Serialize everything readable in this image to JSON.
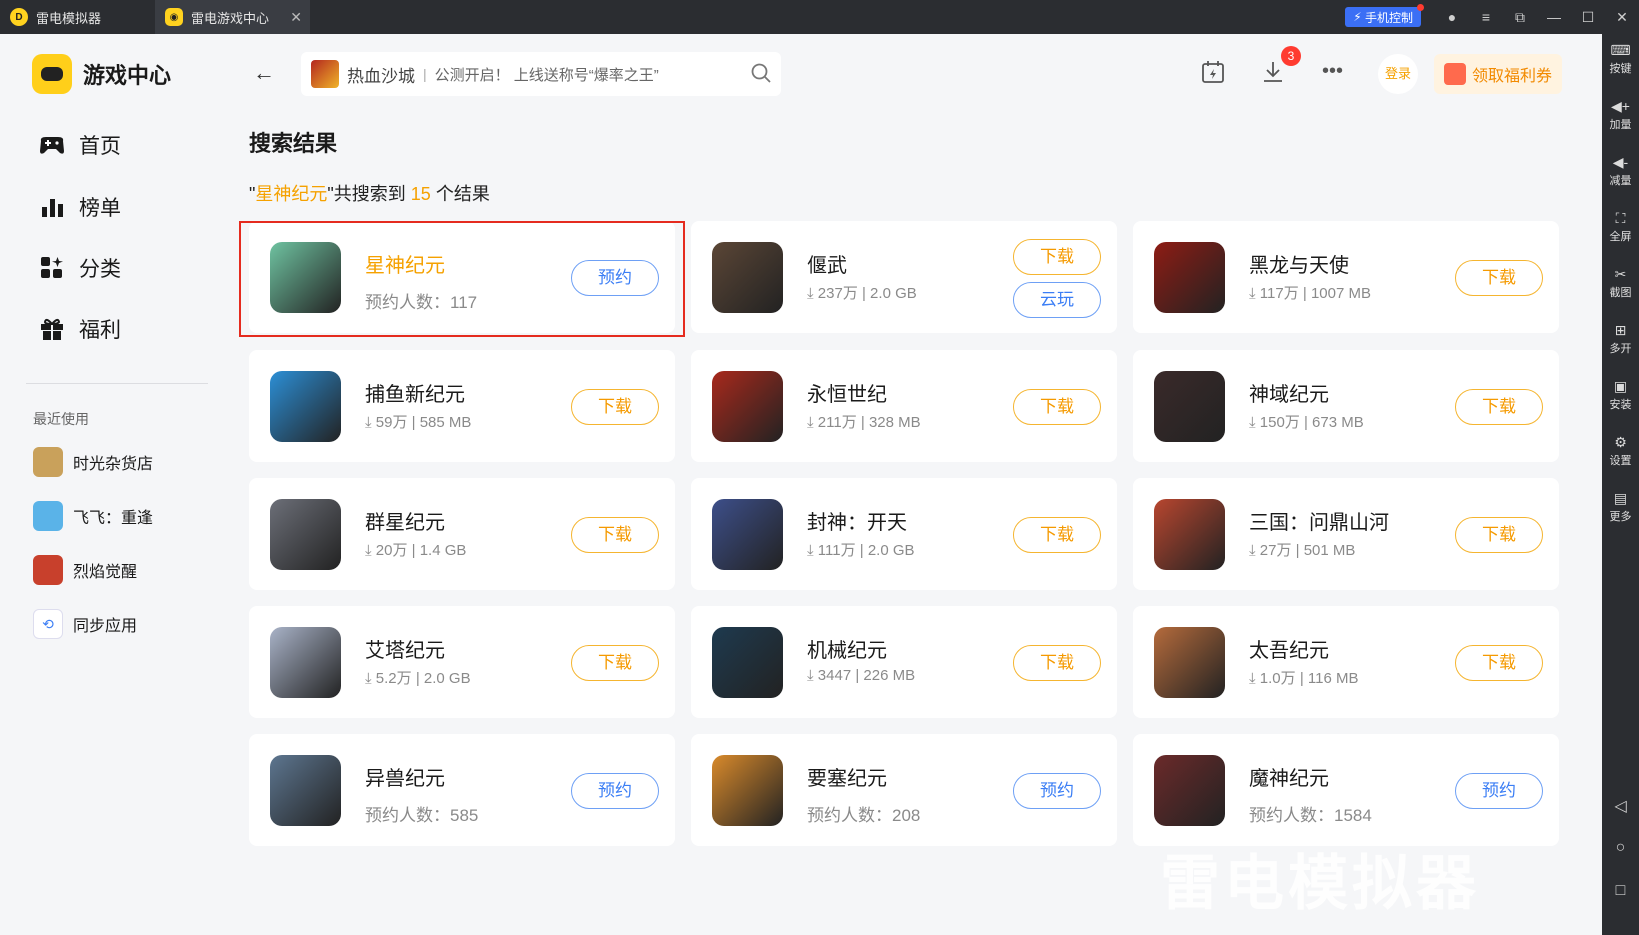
{
  "titlebar": {
    "tabs": [
      {
        "label": "雷电模拟器"
      },
      {
        "label": "雷电游戏中心"
      }
    ],
    "phone_control": "手机控制"
  },
  "right_toolbar": {
    "items": [
      {
        "label": "按键",
        "icon": "keyboard-icon"
      },
      {
        "label": "加量",
        "icon": "volume-up-icon"
      },
      {
        "label": "减量",
        "icon": "volume-down-icon"
      },
      {
        "label": "全屏",
        "icon": "fullscreen-icon"
      },
      {
        "label": "截图",
        "icon": "scissors-icon"
      },
      {
        "label": "多开",
        "icon": "multi-instance-icon"
      },
      {
        "label": "安装",
        "icon": "apk-icon"
      },
      {
        "label": "设置",
        "icon": "gear-icon"
      },
      {
        "label": "更多",
        "icon": "more-icon"
      }
    ]
  },
  "sidebar": {
    "brand": "游戏中心",
    "nav": [
      {
        "label": "首页",
        "icon": "gamepad-icon"
      },
      {
        "label": "榜单",
        "icon": "chart-icon"
      },
      {
        "label": "分类",
        "icon": "category-icon"
      },
      {
        "label": "福利",
        "icon": "gift-icon"
      }
    ],
    "recent_title": "最近使用",
    "recent": [
      {
        "label": "时光杂货店",
        "color": "#c9a15b"
      },
      {
        "label": "飞飞：重逢",
        "color": "#5ab3e8"
      },
      {
        "label": "烈焰觉醒",
        "color": "#c8402c"
      },
      {
        "label": "同步应用",
        "color": "#3b7ef5"
      }
    ]
  },
  "search": {
    "game": "热血沙城",
    "separator": "|",
    "hint": "公测开启！ 上线送称号“爆率之王”"
  },
  "header": {
    "download_badge": "3",
    "login": "登录",
    "welfare": "领取福利券"
  },
  "results": {
    "title": "搜索结果",
    "query": "星神纪元",
    "summary_mid": "共搜索到",
    "count": "15",
    "summary_end": "个结果",
    "games": [
      {
        "name": "星神纪元",
        "meta": "预约人数：117",
        "btn": "预约",
        "type": "rs",
        "color": "#6fc3a1"
      },
      {
        "name": "偃武",
        "meta": "⤓ 237万 | 2.0 GB",
        "btn": "下载",
        "btn2": "云玩",
        "type": "dl",
        "color": "#5b4636"
      },
      {
        "name": "黑龙与天使",
        "meta": "⤓ 117万 | 1007 MB",
        "btn": "下载",
        "type": "dl",
        "color": "#8e1c14"
      },
      {
        "name": "捕鱼新纪元",
        "meta": "⤓ 59万 | 585 MB",
        "btn": "下载",
        "type": "dl",
        "color": "#2c8fd6"
      },
      {
        "name": "永恒世纪",
        "meta": "⤓ 211万 | 328 MB",
        "btn": "下载",
        "type": "dl",
        "color": "#a8291c"
      },
      {
        "name": "神域纪元",
        "meta": "⤓ 150万 | 673 MB",
        "btn": "下载",
        "type": "dl",
        "color": "#3a2a2a"
      },
      {
        "name": "群星纪元",
        "meta": "⤓ 20万 | 1.4 GB",
        "btn": "下载",
        "type": "dl",
        "color": "#6c6f78"
      },
      {
        "name": "封神：开天",
        "meta": "⤓ 111万 | 2.0 GB",
        "btn": "下载",
        "type": "dl",
        "color": "#3d4f8a"
      },
      {
        "name": "三国：问鼎山河",
        "meta": "⤓ 27万 | 501 MB",
        "btn": "下载",
        "type": "dl",
        "color": "#b8462f"
      },
      {
        "name": "艾塔纪元",
        "meta": "⤓ 5.2万 | 2.0 GB",
        "btn": "下载",
        "type": "dl",
        "color": "#a9b3c8"
      },
      {
        "name": "机械纪元",
        "meta": "⤓ 3447 | 226 MB",
        "btn": "下载",
        "type": "dl",
        "color": "#1e3a4f"
      },
      {
        "name": "太吾纪元",
        "meta": "⤓ 1.0万 | 116 MB",
        "btn": "下载",
        "type": "dl",
        "color": "#b56b3c"
      },
      {
        "name": "异兽纪元",
        "meta": "预约人数：585",
        "btn": "预约",
        "type": "rs",
        "color": "#5d7690"
      },
      {
        "name": "要塞纪元",
        "meta": "预约人数：208",
        "btn": "预约",
        "type": "rs",
        "color": "#d98a2b"
      },
      {
        "name": "魔神纪元",
        "meta": "预约人数：1584",
        "btn": "预约",
        "type": "rs",
        "color": "#6b2a2a"
      }
    ]
  },
  "watermark": "雷电模拟器"
}
